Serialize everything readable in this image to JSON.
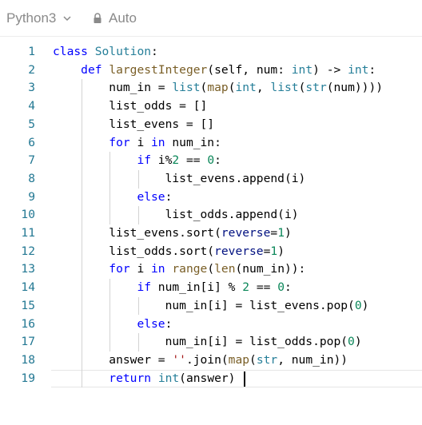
{
  "toolbar": {
    "language": "Python3",
    "language_icon": "chevron-down-icon",
    "mode": "Auto",
    "mode_icon": "lock-icon"
  },
  "editor": {
    "lines": [
      {
        "n": "1",
        "tokens": [
          [
            "kw",
            "class"
          ],
          [
            "",
            " "
          ],
          [
            "cls",
            "Solution"
          ],
          [
            "",
            ":"
          ]
        ]
      },
      {
        "n": "2",
        "tokens": [
          [
            "",
            "    "
          ],
          [
            "kw",
            "def"
          ],
          [
            "",
            " "
          ],
          [
            "fn",
            "largestInteger"
          ],
          [
            "",
            "(self, num: "
          ],
          [
            "cls",
            "int"
          ],
          [
            "",
            ") -> "
          ],
          [
            "cls",
            "int"
          ],
          [
            "",
            ":"
          ]
        ]
      },
      {
        "n": "3",
        "tokens": [
          [
            "",
            "        num_in = "
          ],
          [
            "cls",
            "list"
          ],
          [
            "",
            "("
          ],
          [
            "fn",
            "map"
          ],
          [
            "",
            "("
          ],
          [
            "cls",
            "int"
          ],
          [
            "",
            ", "
          ],
          [
            "cls",
            "list"
          ],
          [
            "",
            "("
          ],
          [
            "cls",
            "str"
          ],
          [
            "",
            "(num))))"
          ]
        ]
      },
      {
        "n": "4",
        "tokens": [
          [
            "",
            "        list_odds = []"
          ]
        ]
      },
      {
        "n": "5",
        "tokens": [
          [
            "",
            "        list_evens = []"
          ]
        ]
      },
      {
        "n": "6",
        "tokens": [
          [
            "",
            "        "
          ],
          [
            "kw",
            "for"
          ],
          [
            "",
            " i "
          ],
          [
            "kw",
            "in"
          ],
          [
            "",
            " num_in:"
          ]
        ]
      },
      {
        "n": "7",
        "tokens": [
          [
            "",
            "            "
          ],
          [
            "kw",
            "if"
          ],
          [
            "",
            " i%"
          ],
          [
            "num",
            "2"
          ],
          [
            "",
            " == "
          ],
          [
            "num",
            "0"
          ],
          [
            "",
            ":"
          ]
        ]
      },
      {
        "n": "8",
        "tokens": [
          [
            "",
            "                list_evens.append(i)"
          ]
        ]
      },
      {
        "n": "9",
        "tokens": [
          [
            "",
            "            "
          ],
          [
            "kw",
            "else"
          ],
          [
            "",
            ":"
          ]
        ]
      },
      {
        "n": "10",
        "tokens": [
          [
            "",
            "                list_odds.append(i)"
          ]
        ]
      },
      {
        "n": "11",
        "tokens": [
          [
            "",
            "        list_evens.sort("
          ],
          [
            "param",
            "reverse"
          ],
          [
            "",
            "="
          ],
          [
            "num",
            "1"
          ],
          [
            "",
            ")"
          ]
        ]
      },
      {
        "n": "12",
        "tokens": [
          [
            "",
            "        list_odds.sort("
          ],
          [
            "param",
            "reverse"
          ],
          [
            "",
            "="
          ],
          [
            "num",
            "1"
          ],
          [
            "",
            ")"
          ]
        ]
      },
      {
        "n": "13",
        "tokens": [
          [
            "",
            "        "
          ],
          [
            "kw",
            "for"
          ],
          [
            "",
            " i "
          ],
          [
            "kw",
            "in"
          ],
          [
            "",
            " "
          ],
          [
            "fn",
            "range"
          ],
          [
            "",
            "("
          ],
          [
            "fn",
            "len"
          ],
          [
            "",
            "(num_in)):"
          ]
        ]
      },
      {
        "n": "14",
        "tokens": [
          [
            "",
            "            "
          ],
          [
            "kw",
            "if"
          ],
          [
            "",
            " num_in[i] % "
          ],
          [
            "num",
            "2"
          ],
          [
            "",
            " == "
          ],
          [
            "num",
            "0"
          ],
          [
            "",
            ":"
          ]
        ]
      },
      {
        "n": "15",
        "tokens": [
          [
            "",
            "                num_in[i] = list_evens.pop("
          ],
          [
            "num",
            "0"
          ],
          [
            "",
            ")"
          ]
        ]
      },
      {
        "n": "16",
        "tokens": [
          [
            "",
            "            "
          ],
          [
            "kw",
            "else"
          ],
          [
            "",
            ":"
          ]
        ]
      },
      {
        "n": "17",
        "tokens": [
          [
            "",
            "                num_in[i] = list_odds.pop("
          ],
          [
            "num",
            "0"
          ],
          [
            "",
            ")"
          ]
        ]
      },
      {
        "n": "18",
        "tokens": [
          [
            "",
            "        answer = "
          ],
          [
            "str",
            "''"
          ],
          [
            "",
            ".join("
          ],
          [
            "fn",
            "map"
          ],
          [
            "",
            "("
          ],
          [
            "cls",
            "str"
          ],
          [
            "",
            ", num_in))"
          ]
        ]
      },
      {
        "n": "19",
        "tokens": [
          [
            "",
            "        "
          ],
          [
            "kw",
            "return"
          ],
          [
            "",
            " "
          ],
          [
            "cls",
            "int"
          ],
          [
            "",
            "(answer) "
          ]
        ]
      }
    ],
    "active_line": 19
  },
  "colors": {
    "keyword": "#0000ff",
    "class": "#267f99",
    "function": "#795e26",
    "number": "#098658",
    "string": "#a31515",
    "line_number": "#237893"
  }
}
